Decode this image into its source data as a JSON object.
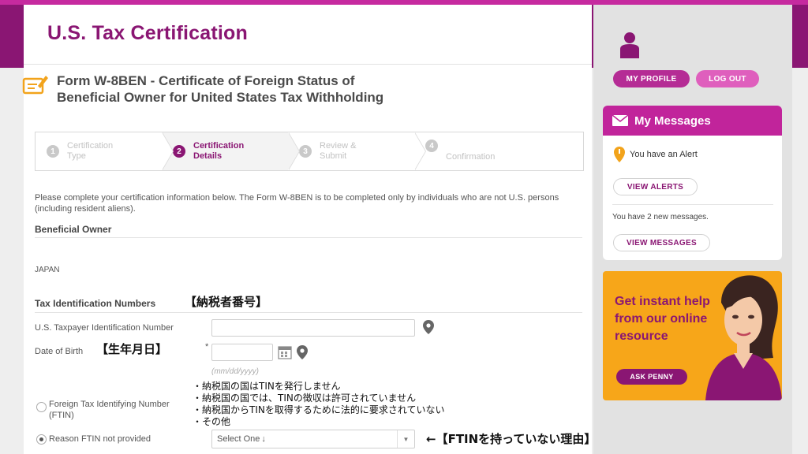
{
  "app": {
    "title": "U.S. Tax Certification"
  },
  "form": {
    "title_line1": "Form W-8BEN - Certificate of Foreign Status of",
    "title_line2": "Beneficial Owner for United States Tax Withholding"
  },
  "steps": [
    {
      "num": "1",
      "label_line1": "Certification",
      "label_line2": "Type",
      "active": false
    },
    {
      "num": "2",
      "label_line1": "Certification",
      "label_line2": "Details",
      "active": true
    },
    {
      "num": "3",
      "label_line1": "Review &",
      "label_line2": "Submit",
      "active": false
    },
    {
      "num": "4",
      "label_line1": "",
      "label_line2": "Confirmation",
      "active": false
    }
  ],
  "intro": "Please complete your certification information below. The Form W-8BEN is to be completed only by individuals who are not U.S. persons (including resident aliens).",
  "beneficial_owner": {
    "heading": "Beneficial Owner",
    "country": "JAPAN"
  },
  "tin": {
    "heading": "Tax Identification Numbers",
    "heading_note": "【納税者番号】",
    "us_tin_label": "U.S. Taxpayer Identification Number",
    "us_tin_value": "",
    "dob_label": "Date of Birth",
    "dob_note": "【生年月日】",
    "dob_required": "*",
    "dob_value": "",
    "dob_hint": "(mm/dd/yyyy)",
    "ftin_label_line1": "Foreign Tax Identifying Number",
    "ftin_label_line2": "(FTIN)",
    "ftin_checked": false,
    "reason_label": "Reason FTIN not provided",
    "reason_checked": true,
    "reason_selected": "Select One",
    "reason_arrow": "↓",
    "reason_note": "←【FTINを持っていない理由】",
    "reason_options": [
      "・納税国の国はTINを発行しません",
      "・納税国の国では、TINの徴収は許可されていません",
      "・納税国からTINを取得するために法的に要求されていない",
      "・その他"
    ]
  },
  "sidebar": {
    "profile_btn": "MY PROFILE",
    "logout_btn": "LOG OUT",
    "messages": {
      "title": "My Messages",
      "alert_text": "You have an Alert",
      "view_alerts": "VIEW ALERTS",
      "new_messages_text": "You have 2 new messages.",
      "view_messages": "VIEW MESSAGES"
    },
    "help": {
      "text": "Get instant help from our online resource",
      "ask_btn": "ASK PENNY"
    }
  },
  "colors": {
    "brand": "#8a1673",
    "accent": "#c1249b",
    "promo": "#f7a619"
  },
  "icons": [
    "form-icon",
    "location-pin-icon",
    "calendar-icon",
    "user-icon",
    "envelope-icon",
    "alert-pin-icon"
  ]
}
